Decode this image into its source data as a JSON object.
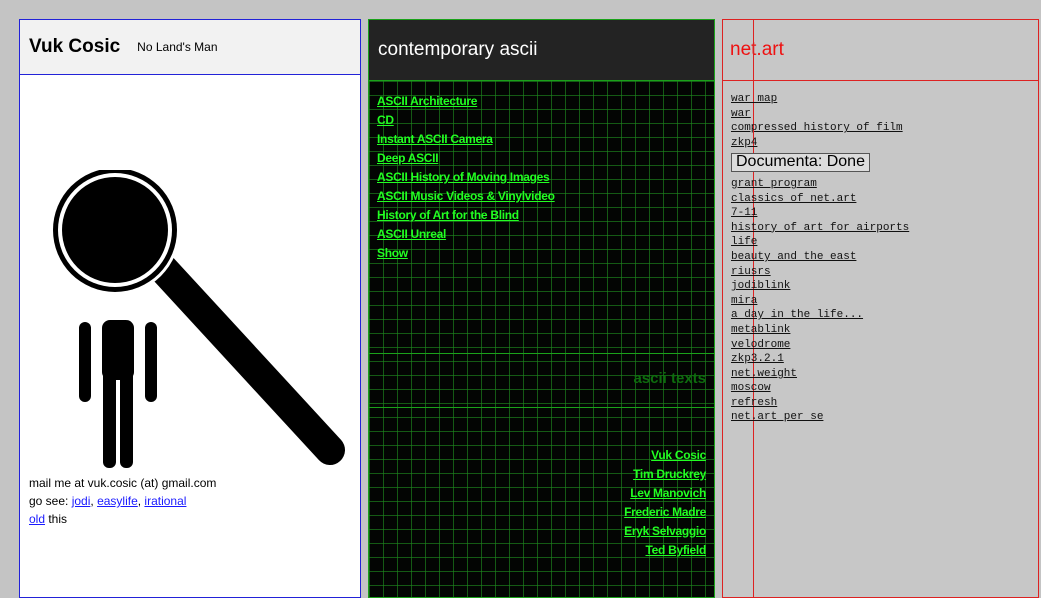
{
  "left": {
    "name": "Vuk Cosic",
    "tagline": "No Land's Man",
    "mail_text": "mail me at vuk.cosic (at) gmail.com",
    "go_see_prefix": "go see: ",
    "links": [
      "jodi",
      "easylife",
      "irational"
    ],
    "old_link": "old",
    "old_suffix": " this",
    "link_color": "#1a1aff",
    "border_color": "#2222d8"
  },
  "middle": {
    "title": "contemporary ascii",
    "links": [
      "ASCII Architecture",
      "CD",
      "Instant ASCII Camera",
      "Deep ASCII",
      "ASCII History of Moving Images",
      "ASCII Music Videos & Vinylvideo",
      "History of Art for the Blind",
      "ASCII Unreal",
      "Show"
    ],
    "texts_heading": "ascii texts",
    "authors": [
      "Vuk Cosic",
      "Tim Druckrey",
      "Lev Manovich",
      "Frederic Madre",
      "Eryk Selvaggio",
      "Ted Byfield"
    ],
    "link_color": "#22ff22",
    "border_color": "#1aa21a"
  },
  "right": {
    "title": "net.art",
    "links_top": [
      "war map",
      "war",
      "compressed history of film",
      "zkp4"
    ],
    "status": "Documenta: Done",
    "links_bottom": [
      "grant program",
      "classics of net.art",
      "7-11",
      "history of art for airports",
      "life",
      "beauty and the east",
      "riusrs",
      "jodiblink",
      "mira",
      "a day in the life...",
      "metablink",
      "velodrome",
      "zkp3.2.1",
      "net.weight",
      "moscow",
      "refresh",
      "net.art per se"
    ],
    "title_color": "#ee1111",
    "border_color": "#dd2222"
  }
}
